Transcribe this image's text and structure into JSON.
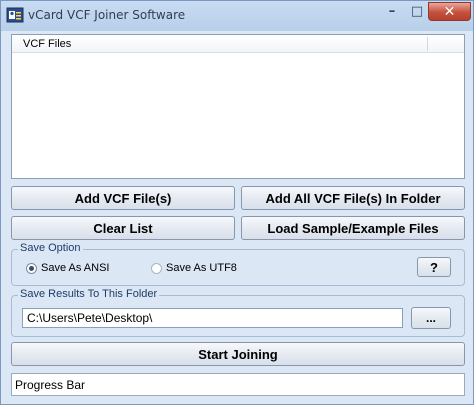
{
  "window": {
    "title": "vCard VCF Joiner Software",
    "controls": {
      "minimize": "–",
      "maximize": "□",
      "close": "✕"
    }
  },
  "file_list": {
    "column_header": "VCF Files",
    "items": []
  },
  "buttons": {
    "add_files": "Add VCF File(s)",
    "add_folder": "Add All VCF File(s) In Folder",
    "clear_list": "Clear List",
    "load_sample": "Load Sample/Example Files",
    "help": "?",
    "browse": "...",
    "start": "Start Joining"
  },
  "save_option": {
    "label": "Save Option",
    "options": [
      {
        "label": "Save As ANSI",
        "selected": true
      },
      {
        "label": "Save As UTF8",
        "selected": false
      }
    ]
  },
  "save_folder": {
    "label": "Save Results To This Folder",
    "path": "C:\\Users\\Pete\\Desktop\\"
  },
  "progress": {
    "label": "Progress Bar"
  }
}
